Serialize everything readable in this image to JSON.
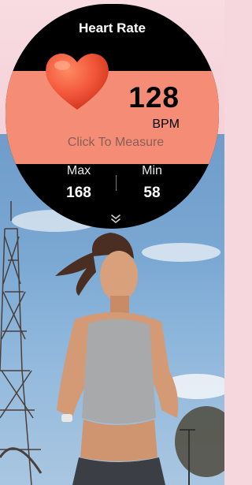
{
  "widget": {
    "title": "Heart Rate",
    "bpm_value": "128",
    "bpm_unit": "BPM",
    "measure_label": "Click To Measure",
    "max_label": "Max",
    "max_value": "168",
    "min_label": "Min",
    "min_value": "58"
  },
  "colors": {
    "band": "#f58d76",
    "heart": "#f2573b",
    "watch_bg": "#000000"
  },
  "icons": {
    "heart": "heart-icon",
    "chevron": "chevron-down-icon"
  }
}
